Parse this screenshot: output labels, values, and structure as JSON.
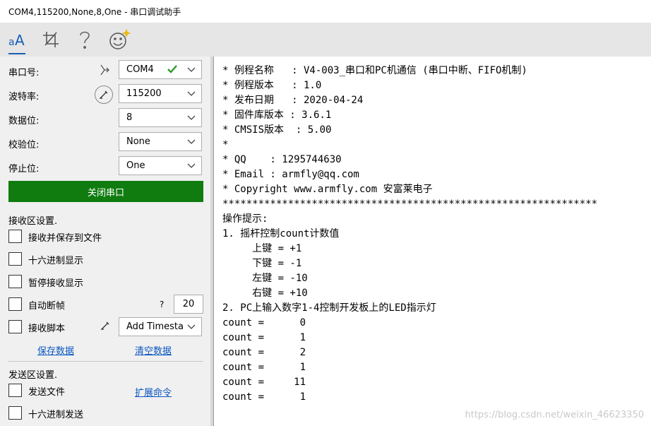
{
  "window": {
    "title": "COM4,115200,None,8,One - 串口调试助手"
  },
  "toolbar": {
    "icons": [
      "font-icon",
      "crop-icon",
      "help-icon",
      "smiley-icon"
    ]
  },
  "serial": {
    "port_label": "串口号:",
    "port_value": "COM4",
    "baud_label": "波特率:",
    "baud_value": "115200",
    "databits_label": "数据位:",
    "databits_value": "8",
    "parity_label": "校验位:",
    "parity_value": "None",
    "stopbits_label": "停止位:",
    "stopbits_value": "One",
    "close_button": "关闭串口"
  },
  "receive_settings": {
    "title": "接收区设置.",
    "save_to_file": "接收并保存到文件",
    "hex_display": "十六进制显示",
    "pause_display": "暂停接收显示",
    "auto_frame": "自动断帧",
    "help_mark": "?",
    "frame_value": "20",
    "script": "接收脚本",
    "script_value": "Add Timesta",
    "save_data": "保存数据",
    "clear_data": "清空数据"
  },
  "send_settings": {
    "title": "发送区设置.",
    "send_file": "发送文件",
    "extend_cmd": "扩展命令",
    "hex_send": "十六进制发送"
  },
  "receive_text": "* 例程名称   : V4-003_串口和PC机通信 (串口中断、FIFO机制)\n* 例程版本   : 1.0\n* 发布日期   : 2020-04-24\n* 固件库版本 : 3.6.1\n* CMSIS版本  : 5.00\n*\n* QQ    : 1295744630\n* Email : armfly@qq.com\n* Copyright www.armfly.com 安富莱电子\n***************************************************************\n操作提示:\n1. 摇杆控制count计数值\n     上键 = +1\n     下键 = -1\n     左键 = -10\n     右键 = +10\n2. PC上输入数字1-4控制开发板上的LED指示灯\ncount =      0\ncount =      1\ncount =      2\ncount =      1\ncount =     11\ncount =      1",
  "watermark": "https://blog.csdn.net/weixin_46623350",
  "colors": {
    "accent": "#107c10",
    "link": "#0b57c0",
    "toolbar_select": "#1a5fb4"
  }
}
